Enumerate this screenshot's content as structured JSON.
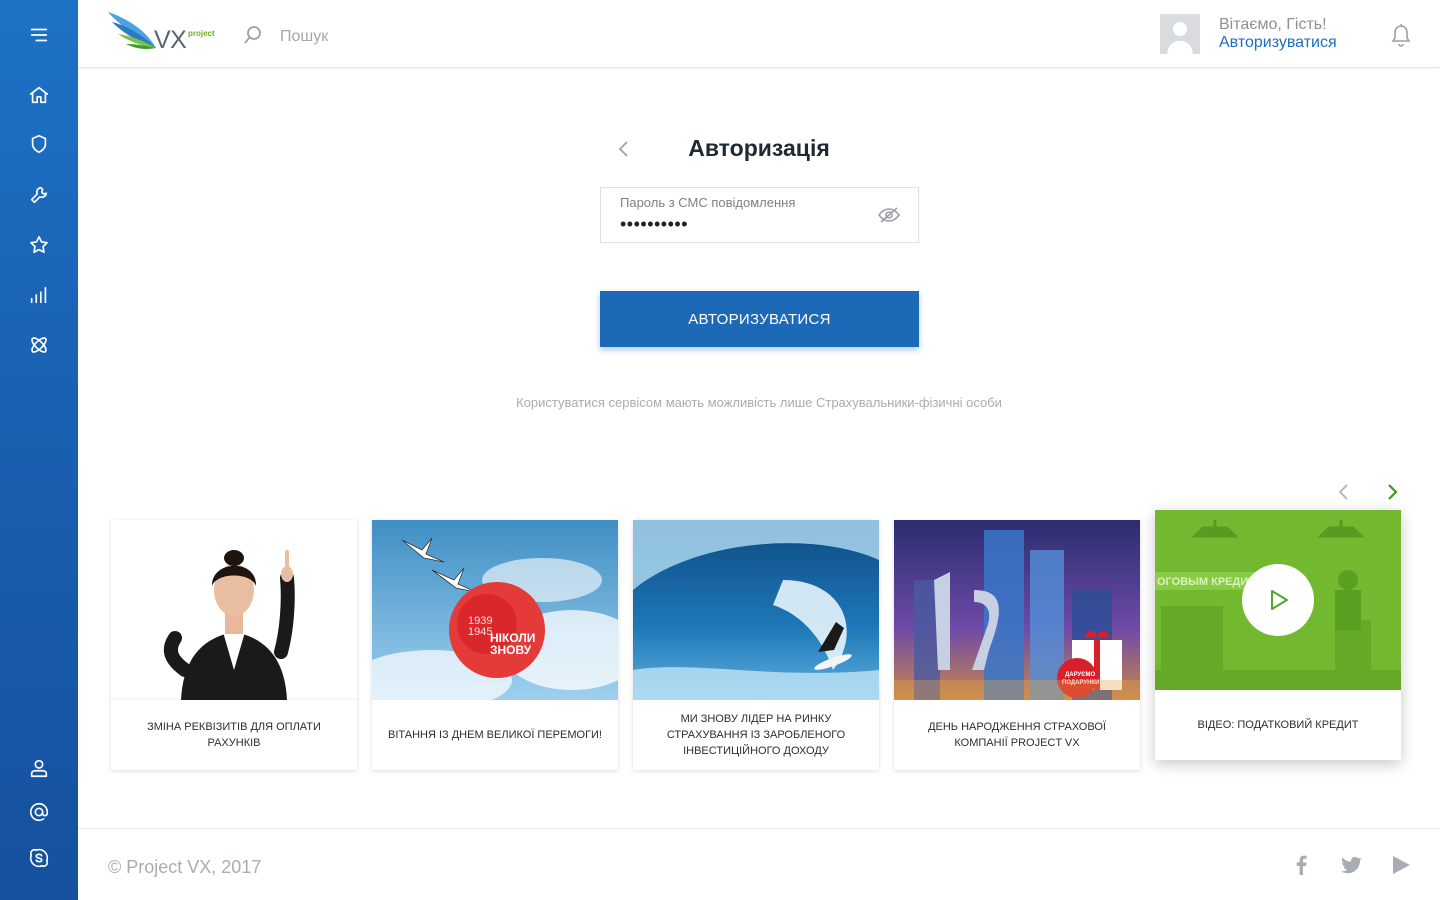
{
  "header": {
    "logo_text": "VX",
    "logo_sub": "project",
    "search_placeholder": "Пошук",
    "greeting": "Вітаємо, Гість!",
    "login_link": "Авторизуватися"
  },
  "sidebar": {
    "items": [
      {
        "icon": "menu-icon"
      },
      {
        "icon": "home-icon"
      },
      {
        "icon": "shield-icon"
      },
      {
        "icon": "tools-icon"
      },
      {
        "icon": "star-icon"
      },
      {
        "icon": "chart-icon"
      },
      {
        "icon": "atom-icon"
      },
      {
        "icon": "user-icon"
      },
      {
        "icon": "at-icon"
      },
      {
        "icon": "skype-icon"
      }
    ]
  },
  "auth": {
    "title": "Авторизація",
    "password_label": "Пароль з СМС повідомлення",
    "password_value": "••••••••••",
    "submit_label": "АВТОРИЗУВАТИСЯ",
    "note": "Користуватися сервісом мають можливість лише Страхувальники-фізичні особи"
  },
  "news": {
    "cards": [
      {
        "title": "Зміна реквізитів для оплати рахунків"
      },
      {
        "title": "Вітання із Днем великої Перемоги!",
        "image_text": [
          "1939",
          "1945",
          "НІКОЛИ",
          "ЗНОВУ"
        ]
      },
      {
        "title": "Ми знову лідер на ринку страхування із заробленого інвестиційного доходу"
      },
      {
        "title": "День народження страхової компанії Project VX",
        "image_text": [
          "ДАРУЄМО",
          "ПОДАРУНКИ"
        ]
      },
      {
        "title": "Відео: податковий кредит",
        "image_text": [
          "ОГОВЫМ КРЕДИТ"
        ]
      }
    ]
  },
  "footer": {
    "copyright": "© Project VX, 2017"
  },
  "colors": {
    "sidebar": "#1a62b4",
    "primary": "#1c69b8",
    "accent_green": "#3a9c1e"
  }
}
